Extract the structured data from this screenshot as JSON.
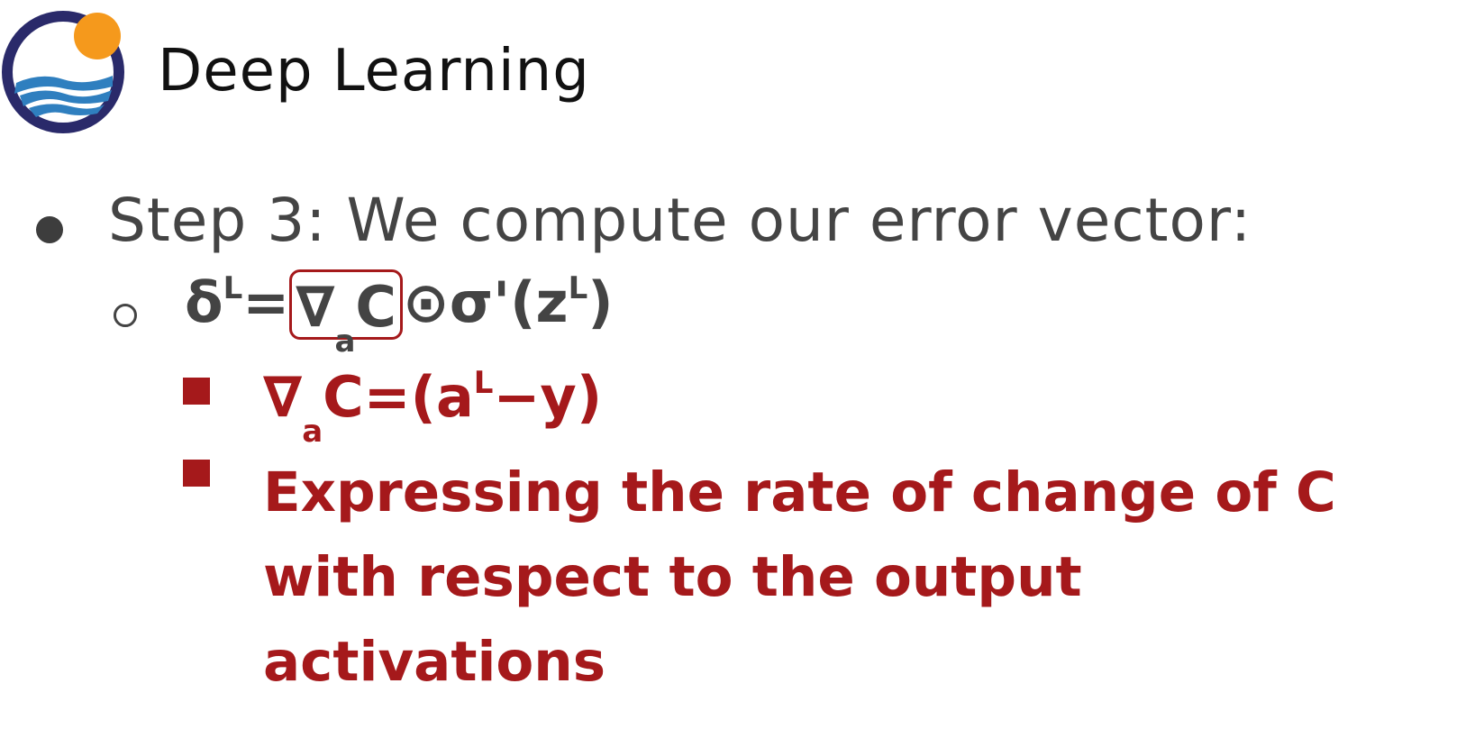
{
  "header": {
    "brand_title": "Deep Learning"
  },
  "colors": {
    "logo_ring": "#2a2a6a",
    "logo_sun": "#f5991c",
    "logo_wave": "#2f7fbf",
    "text_gray": "#444444",
    "accent_red": "#a5191b"
  },
  "content": {
    "step_text": "Step 3: We compute our error vector:",
    "formula": {
      "delta": "δ",
      "delta_sup": "L",
      "equals": "=",
      "nabla": "∇",
      "nabla_sub": "a",
      "c": "C",
      "odot": "⊙",
      "sigma_prime": "σ'(z",
      "z_sup": "L",
      "close": ")"
    },
    "red_formula": {
      "nabla": "∇",
      "sub": "a",
      "body": "C=(a",
      "sup": "L",
      "tail": "−y)"
    },
    "explanation_lines": [
      "Expressing the rate of change of C",
      "with respect to the output",
      "activations"
    ]
  }
}
